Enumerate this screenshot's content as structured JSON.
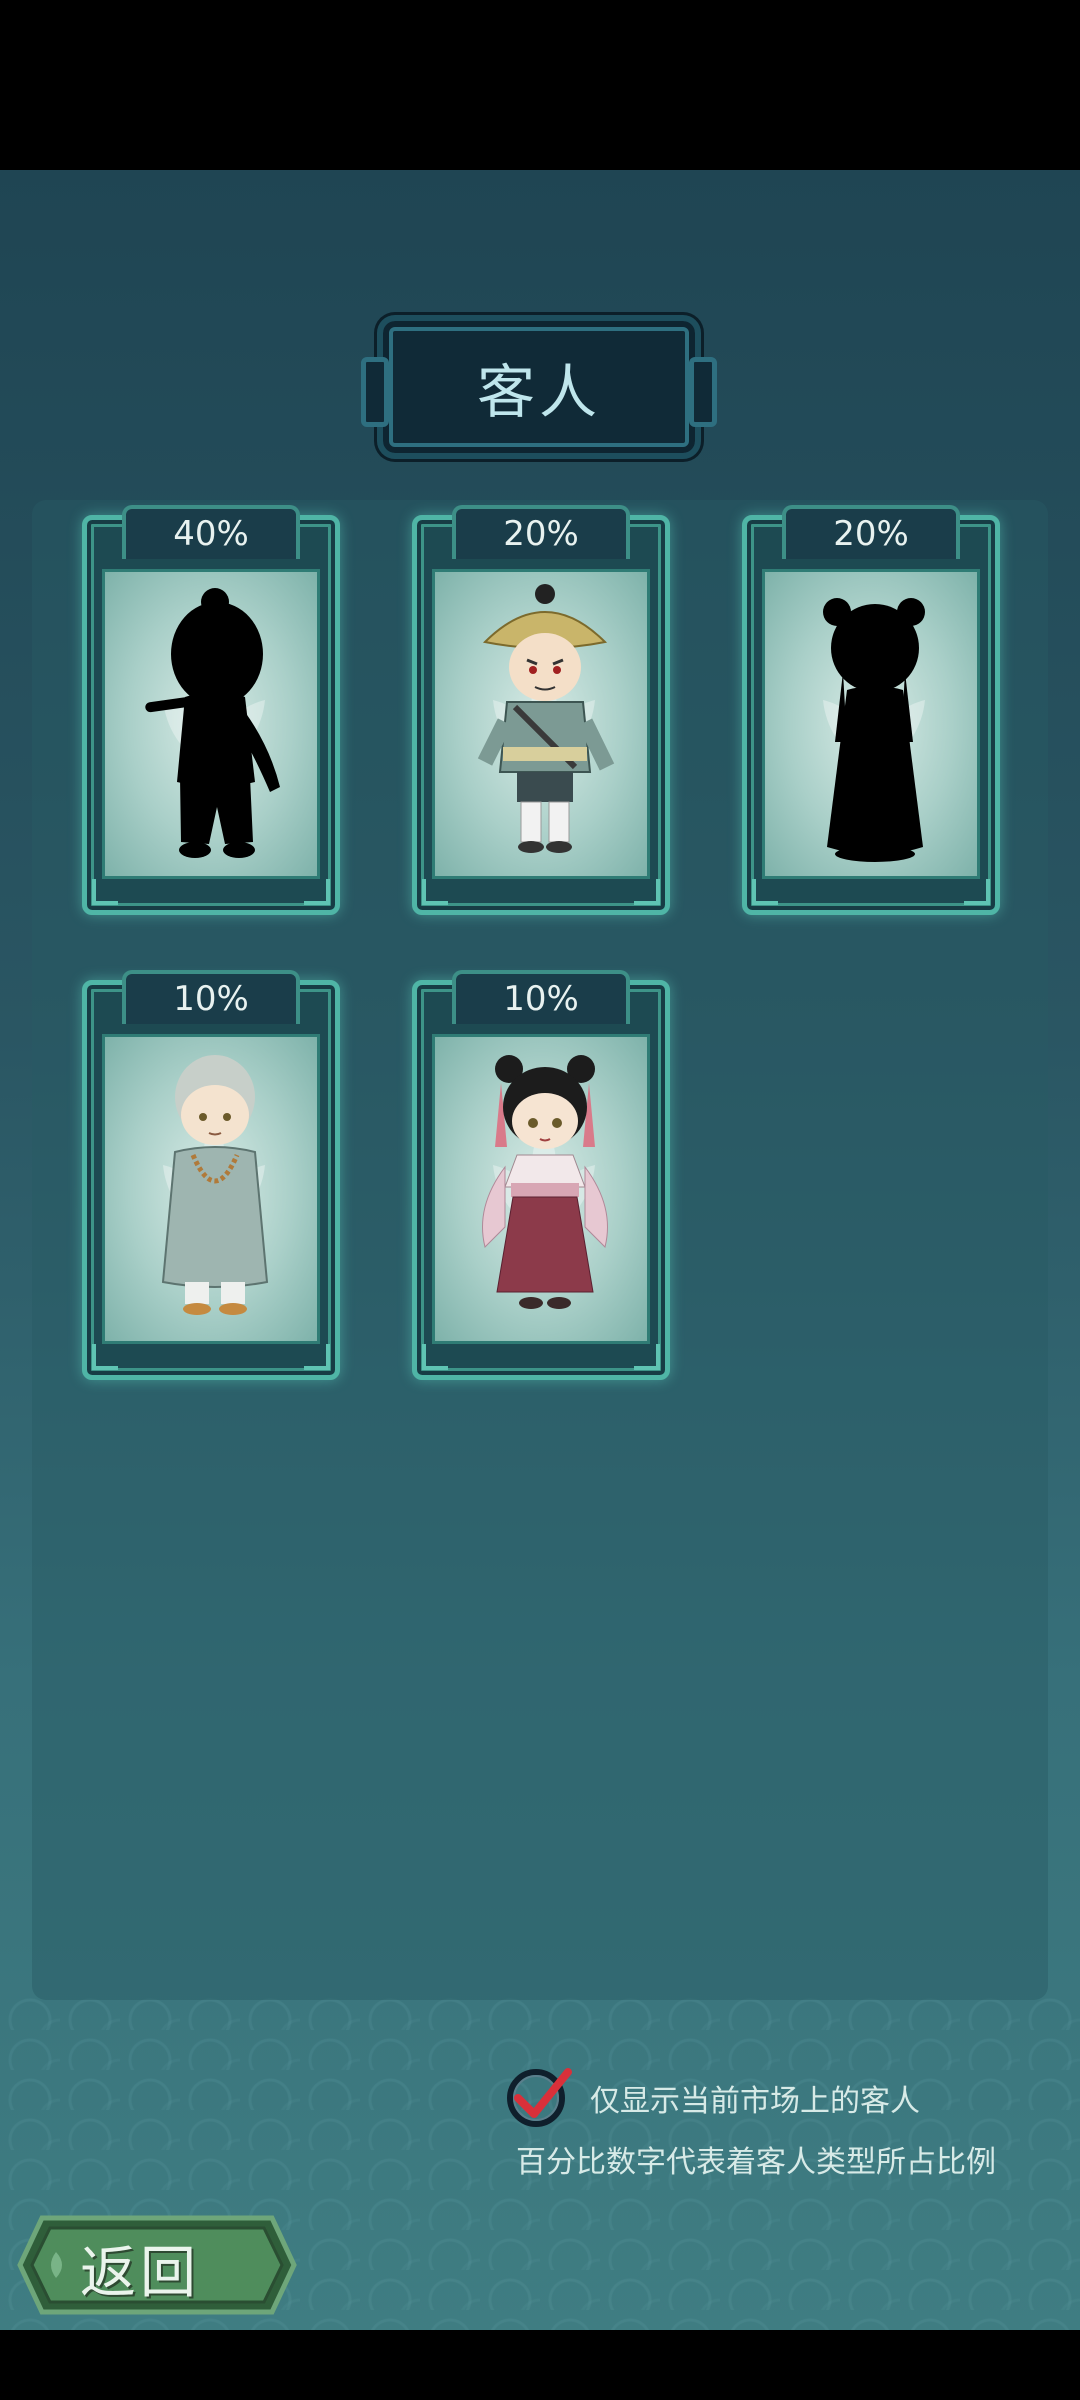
{
  "title": "客人",
  "customers": [
    {
      "percent": "40%",
      "revealed": false,
      "character": "male-silhouette-icon"
    },
    {
      "percent": "20%",
      "revealed": true,
      "character": "straw-hat-laborer"
    },
    {
      "percent": "20%",
      "revealed": false,
      "character": "female-silhouette-icon"
    },
    {
      "percent": "10%",
      "revealed": true,
      "character": "monk"
    },
    {
      "percent": "10%",
      "revealed": true,
      "character": "young-lady"
    }
  ],
  "filter": {
    "label": "仅显示当前市场上的客人",
    "checked": true
  },
  "note": "百分比数字代表着客人类型所占比例",
  "back_label": "返回",
  "colors": {
    "accent": "#4fb5a6",
    "check": "#d9303a",
    "panel": "#1f4553"
  }
}
